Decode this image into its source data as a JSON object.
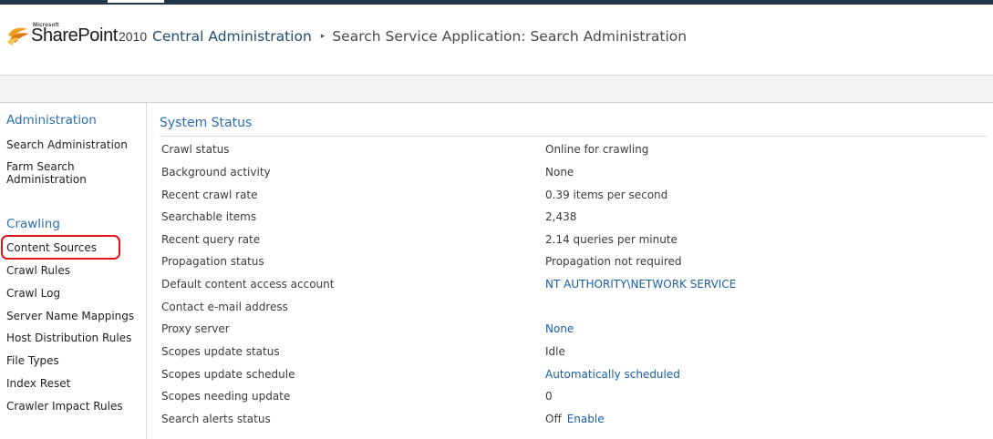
{
  "header": {
    "logo": {
      "microsoft": "Microsoft",
      "product": "SharePoint",
      "year": "2010"
    },
    "breadcrumb": {
      "root": "Central Administration",
      "separator": "▸",
      "current": "Search Service Application: Search Administration"
    }
  },
  "sidebar": {
    "administration_heading": "Administration",
    "administration_items": [
      {
        "label": "Search Administration"
      },
      {
        "label": "Farm Search Administration"
      }
    ],
    "crawling_heading": "Crawling",
    "crawling_items": [
      {
        "label": "Content Sources"
      },
      {
        "label": "Crawl Rules"
      },
      {
        "label": "Crawl Log"
      },
      {
        "label": "Server Name Mappings"
      },
      {
        "label": "Host Distribution Rules"
      },
      {
        "label": "File Types"
      },
      {
        "label": "Index Reset"
      },
      {
        "label": "Crawler Impact Rules"
      }
    ],
    "highlighted_item": "Content Sources"
  },
  "system_status": {
    "title": "System Status",
    "rows": [
      {
        "label": "Crawl status",
        "value": "Online for crawling"
      },
      {
        "label": "Background activity",
        "value": "None"
      },
      {
        "label": "Recent crawl rate",
        "value": "0.39 items per second"
      },
      {
        "label": "Searchable items",
        "value": "2,438"
      },
      {
        "label": "Recent query rate",
        "value": "2.14 queries per minute"
      },
      {
        "label": "Propagation status",
        "value": "Propagation not required"
      },
      {
        "label": "Default content access account",
        "value": "NT AUTHORITY\\NETWORK SERVICE"
      },
      {
        "label": "Contact e-mail address",
        "value": ""
      },
      {
        "label": "Proxy server",
        "value": "None"
      },
      {
        "label": "Scopes update status",
        "value": "Idle"
      },
      {
        "label": "Scopes update schedule",
        "value": "Automatically scheduled"
      },
      {
        "label": "Scopes needing update",
        "value": "0"
      },
      {
        "label": "Search alerts status",
        "value": "Off",
        "action": "Enable"
      }
    ]
  },
  "colors": {
    "top_strip": "#21374c",
    "link": "#1a5fa8",
    "heading": "#2a70b0",
    "highlight_ring": "#e0141b"
  }
}
